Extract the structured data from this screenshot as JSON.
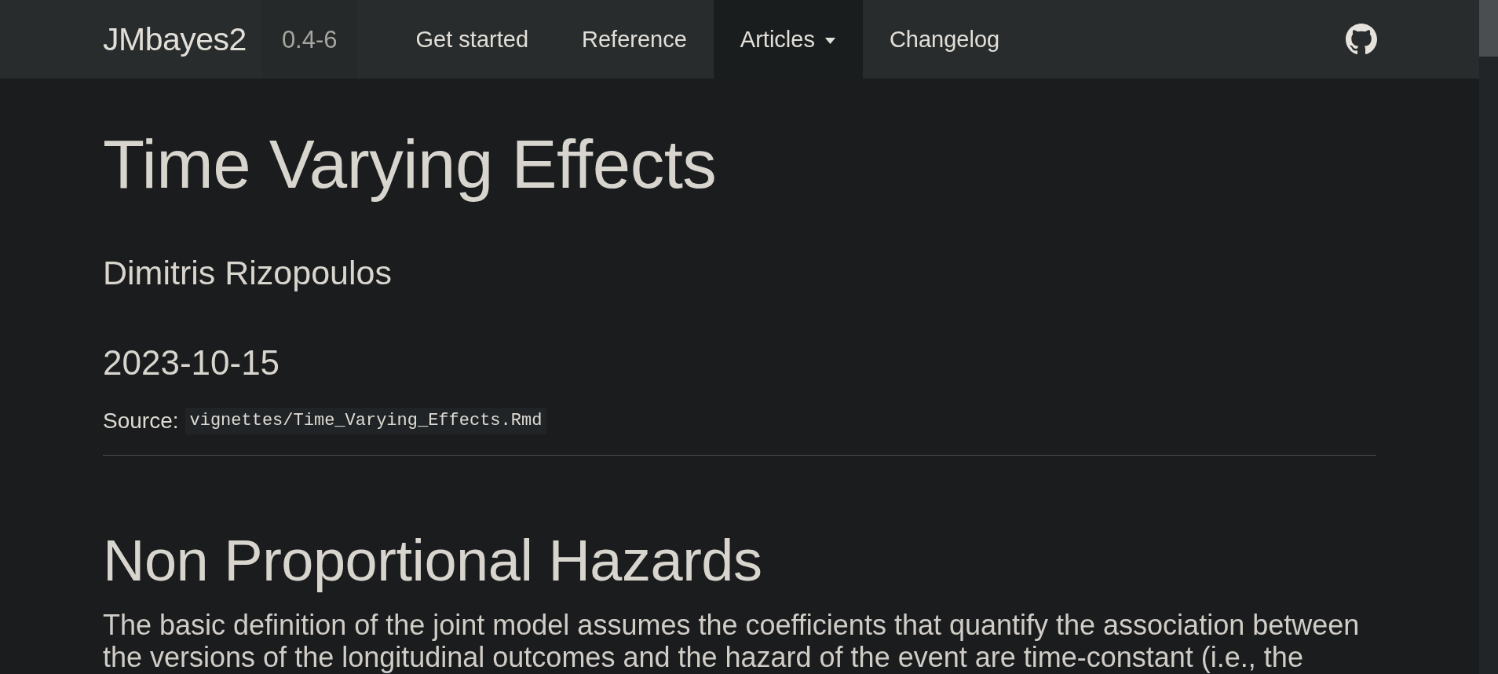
{
  "navbar": {
    "brand": "JMbayes2",
    "version": "0.4-6",
    "links": [
      {
        "label": "Get started",
        "kind": "link",
        "selected": false
      },
      {
        "label": "Reference",
        "kind": "link",
        "selected": false
      },
      {
        "label": "Articles",
        "kind": "dropdown",
        "selected": true
      },
      {
        "label": "Changelog",
        "kind": "link",
        "selected": false
      }
    ]
  },
  "header": {
    "title": "Time Varying Effects",
    "author": "Dimitris Rizopoulos",
    "date": "2023-10-15",
    "source": {
      "label": "Source:",
      "path": "vignettes/Time_Varying_Effects.Rmd"
    }
  },
  "section": {
    "heading": "Non Proportional Hazards",
    "paragraph": "The basic definition of the joint model assumes the coefficients that quantify the association between the versions of the longitudinal outcomes and the hazard of the event are time-constant (i.e., the"
  }
}
